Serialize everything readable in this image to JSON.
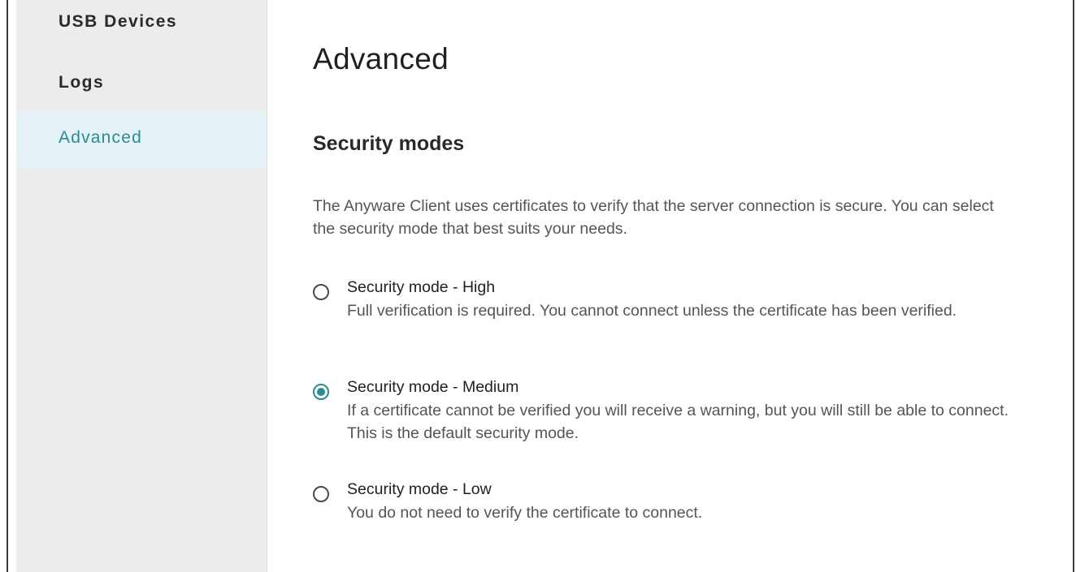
{
  "sidebar": {
    "items": [
      {
        "label": "USB Devices",
        "active": false
      },
      {
        "label": "Logs",
        "active": false
      },
      {
        "label": "Advanced",
        "active": true
      }
    ]
  },
  "main": {
    "title": "Advanced",
    "section_title": "Security modes",
    "intro": "The Anyware Client uses certificates to verify that the server connection is secure. You can select the security mode that best suits your needs.",
    "options": [
      {
        "title": "Security mode - High",
        "description": "Full verification is required. You cannot connect unless the certificate has been verified.",
        "selected": false
      },
      {
        "title": "Security mode - Medium",
        "description": "If a certificate cannot be verified you will receive a warning, but you will still be able to connect. This is the default security mode.",
        "selected": true
      },
      {
        "title": "Security mode - Low",
        "description": "You do not need to verify the certificate to connect.",
        "selected": false
      }
    ]
  },
  "colors": {
    "accent": "#2a8c92",
    "sidebar_bg": "#ececec",
    "active_item_bg": "#e4f2f5",
    "body_text": "#555555"
  }
}
